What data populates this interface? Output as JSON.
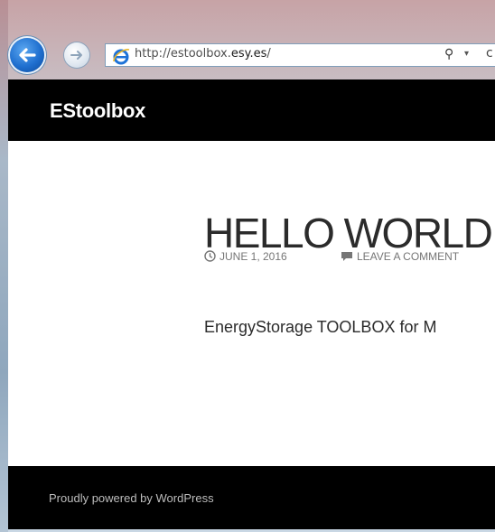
{
  "browser": {
    "url_prefix": "http://estoolbox.",
    "url_domain": "esy.es",
    "url_suffix": "/"
  },
  "site": {
    "title": "EStoolbox"
  },
  "post": {
    "title": "HELLO WORLD",
    "date": "JUNE 1, 2016",
    "comment_link": "LEAVE A COMMENT",
    "excerpt": "EnergyStorage TOOLBOX for M"
  },
  "footer": {
    "text": "Proudly powered by WordPress"
  },
  "icons": {
    "back": "back-arrow-icon",
    "forward": "forward-arrow-icon",
    "browser": "internet-explorer-icon",
    "search": "search-icon",
    "clock": "clock-icon",
    "comment": "comment-icon"
  },
  "colors": {
    "header_bg": "#000000",
    "footer_bg": "#000000",
    "accent": "#1f6fcf"
  }
}
